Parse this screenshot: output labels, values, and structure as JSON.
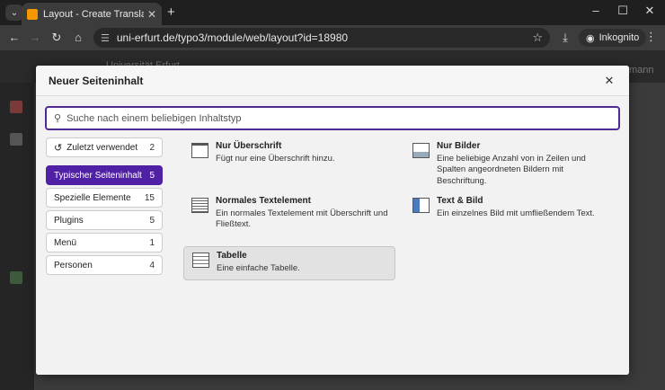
{
  "browser": {
    "tab_title": "Layout - Create Translation · Uni",
    "url": "uni-erfurt.de/typo3/module/web/layout?id=18980",
    "incognito_label": "Inkognito"
  },
  "modal": {
    "title": "Neuer Seiteninhalt",
    "search_placeholder": "Suche nach einem beliebigen Inhaltstyp",
    "categories": [
      {
        "label": "Zuletzt verwendet",
        "count": "2"
      },
      {
        "label": "Typischer Seiteninhalt",
        "count": "5"
      },
      {
        "label": "Spezielle Elemente",
        "count": "15"
      },
      {
        "label": "Plugins",
        "count": "5"
      },
      {
        "label": "Menü",
        "count": "1"
      },
      {
        "label": "Personen",
        "count": "4"
      }
    ],
    "items": [
      {
        "title": "Nur Überschrift",
        "desc": "Fügt nur eine Überschrift hinzu."
      },
      {
        "title": "Nur Bilder",
        "desc": "Eine beliebige Anzahl von in Zeilen und Spalten angeordneten Bildern mit Beschriftung."
      },
      {
        "title": "Normales Textelement",
        "desc": "Ein normales Textelement mit Überschrift und Fließtext."
      },
      {
        "title": "Text & Bild",
        "desc": "Ein einzelnes Bild mit umfließendem Text."
      },
      {
        "title": "Tabelle",
        "desc": "Eine einfache Tabelle."
      }
    ]
  },
  "background": {
    "site_name": "Universität Erfurt",
    "user_partial": "mann"
  },
  "colors": {
    "accent": "#5020a5",
    "chrome_dark": "#1f1f1f",
    "typo3_orange": "#f49700"
  }
}
